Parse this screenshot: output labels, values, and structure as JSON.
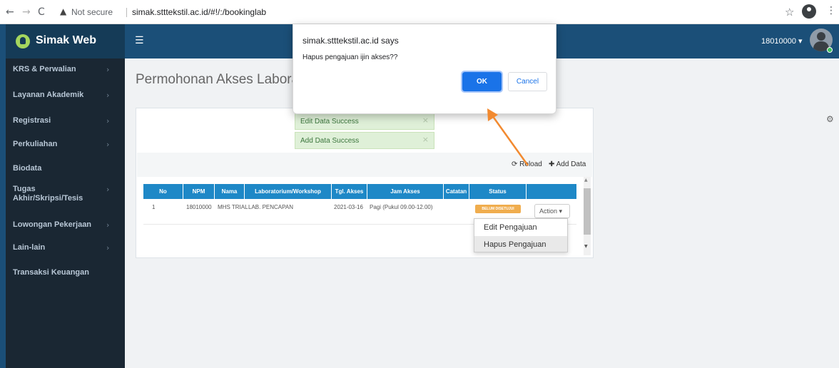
{
  "browser": {
    "security_label": "Not secure",
    "url": "simak.stttekstil.ac.id/#!/:/bookinglab"
  },
  "app": {
    "brand": "Simak Web",
    "user": "18010000 ▾"
  },
  "sidebar": {
    "items": [
      {
        "label": "KRS & Perwalian"
      },
      {
        "label": "Layanan Akademik"
      },
      {
        "label": "Registrasi"
      },
      {
        "label": "Perkuliahan"
      },
      {
        "label": "Biodata"
      },
      {
        "label": "Tugas Akhir/Skripsi/Tesis"
      },
      {
        "label": "Lowongan Pekerjaan"
      },
      {
        "label": "Lain-lain"
      },
      {
        "label": "Transaksi Keuangan"
      }
    ]
  },
  "page": {
    "title": "Permohonan Akses Laborat"
  },
  "alerts": [
    {
      "message": "Edit Data Success"
    },
    {
      "message": "Add Data Success"
    }
  ],
  "toolbar": {
    "reload_label": "Reload",
    "add_label": "Add Data"
  },
  "table": {
    "headers": [
      "No",
      "NPM",
      "Nama",
      "Laboratorium/Workshop",
      "Tgl. Akses",
      "Jam Akses",
      "Catatan",
      "Status",
      ""
    ],
    "rows": [
      {
        "no": "1",
        "npm": "18010000",
        "nama": "MHS TRIAL",
        "lab": "LAB. PENCAPAN",
        "tgl": "2021-03-16",
        "jam": "Pagi (Pukul 09.00-12.00)",
        "catatan": "",
        "status": "BELUM DISETUJUI",
        "action": "Action ▾"
      }
    ]
  },
  "dropdown": {
    "options": [
      "Edit Pengajuan",
      "Hapus Pengajuan"
    ]
  },
  "dialog": {
    "title": "simak.stttekstil.ac.id says",
    "message": "Hapus pengajuan ijin akses??",
    "ok_label": "OK",
    "cancel_label": "Cancel"
  },
  "colors": {
    "topbar": "#1b4f78",
    "sidebar": "#1a2733",
    "table_header": "#1e88c7",
    "status_badge": "#f0ad4e",
    "ok_button": "#1a73e8",
    "annotation_arrow": "#f28a30"
  }
}
